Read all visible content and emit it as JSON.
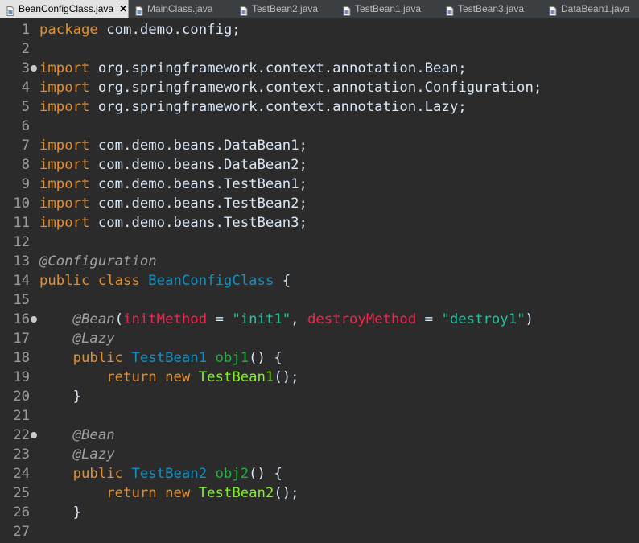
{
  "tabs": [
    {
      "label": "BeanConfigClass.java",
      "active": true,
      "close": "✕",
      "icon": "java-file-icon"
    },
    {
      "label": "MainClass.java",
      "active": false,
      "icon": "java-file-icon"
    },
    {
      "label": "TestBean2.java",
      "active": false,
      "icon": "java-file-icon"
    },
    {
      "label": "TestBean1.java",
      "active": false,
      "icon": "java-file-icon"
    },
    {
      "label": "TestBean3.java",
      "active": false,
      "icon": "java-file-icon"
    },
    {
      "label": "DataBean1.java",
      "active": false,
      "icon": "java-file-icon"
    }
  ],
  "code": {
    "lines": [
      {
        "n": "1",
        "fold": false,
        "tokens": [
          {
            "t": "package",
            "k": "kw"
          },
          {
            "t": " com.demo.config;",
            "k": "pl"
          }
        ]
      },
      {
        "n": "2",
        "fold": false,
        "tokens": []
      },
      {
        "n": "3",
        "fold": true,
        "tokens": [
          {
            "t": "import",
            "k": "kw"
          },
          {
            "t": " org.springframework.context.annotation.Bean;",
            "k": "pl"
          }
        ]
      },
      {
        "n": "4",
        "fold": false,
        "tokens": [
          {
            "t": "import",
            "k": "kw"
          },
          {
            "t": " org.springframework.context.annotation.Configuration;",
            "k": "pl"
          }
        ]
      },
      {
        "n": "5",
        "fold": false,
        "tokens": [
          {
            "t": "import",
            "k": "kw"
          },
          {
            "t": " org.springframework.context.annotation.Lazy;",
            "k": "pl"
          }
        ]
      },
      {
        "n": "6",
        "fold": false,
        "tokens": []
      },
      {
        "n": "7",
        "fold": false,
        "tokens": [
          {
            "t": "import",
            "k": "kw"
          },
          {
            "t": " com.demo.beans.DataBean1;",
            "k": "pl"
          }
        ]
      },
      {
        "n": "8",
        "fold": false,
        "tokens": [
          {
            "t": "import",
            "k": "kw"
          },
          {
            "t": " com.demo.beans.DataBean2;",
            "k": "pl"
          }
        ]
      },
      {
        "n": "9",
        "fold": false,
        "tokens": [
          {
            "t": "import",
            "k": "kw"
          },
          {
            "t": " com.demo.beans.TestBean1;",
            "k": "pl"
          }
        ]
      },
      {
        "n": "10",
        "fold": false,
        "tokens": [
          {
            "t": "import",
            "k": "kw"
          },
          {
            "t": " com.demo.beans.TestBean2;",
            "k": "pl"
          }
        ]
      },
      {
        "n": "11",
        "fold": false,
        "tokens": [
          {
            "t": "import",
            "k": "kw"
          },
          {
            "t": " com.demo.beans.TestBean3;",
            "k": "pl"
          }
        ]
      },
      {
        "n": "12",
        "fold": false,
        "tokens": []
      },
      {
        "n": "13",
        "fold": false,
        "tokens": [
          {
            "t": "@Configuration",
            "k": "ann"
          }
        ]
      },
      {
        "n": "14",
        "fold": false,
        "tokens": [
          {
            "t": "public",
            "k": "kw"
          },
          {
            "t": " ",
            "k": "pl"
          },
          {
            "t": "class",
            "k": "kw"
          },
          {
            "t": " ",
            "k": "pl"
          },
          {
            "t": "BeanConfigClass",
            "k": "cls"
          },
          {
            "t": " {",
            "k": "pl"
          }
        ]
      },
      {
        "n": "15",
        "fold": false,
        "tokens": []
      },
      {
        "n": "16",
        "fold": true,
        "tokens": [
          {
            "t": "    ",
            "k": "pl"
          },
          {
            "t": "@Bean",
            "k": "ann"
          },
          {
            "t": "(",
            "k": "pl"
          },
          {
            "t": "initMethod",
            "k": "prm"
          },
          {
            "t": " = ",
            "k": "pl"
          },
          {
            "t": "\"init1\"",
            "k": "str"
          },
          {
            "t": ", ",
            "k": "pl"
          },
          {
            "t": "destroyMethod",
            "k": "prm"
          },
          {
            "t": " = ",
            "k": "pl"
          },
          {
            "t": "\"destroy1\"",
            "k": "str"
          },
          {
            "t": ")",
            "k": "pl"
          }
        ]
      },
      {
        "n": "17",
        "fold": false,
        "tokens": [
          {
            "t": "    ",
            "k": "pl"
          },
          {
            "t": "@Lazy",
            "k": "ann"
          }
        ]
      },
      {
        "n": "18",
        "fold": false,
        "tokens": [
          {
            "t": "    ",
            "k": "pl"
          },
          {
            "t": "public",
            "k": "kw"
          },
          {
            "t": " ",
            "k": "pl"
          },
          {
            "t": "TestBean1",
            "k": "typ"
          },
          {
            "t": " ",
            "k": "pl"
          },
          {
            "t": "obj1",
            "k": "mth"
          },
          {
            "t": "() {",
            "k": "pl"
          }
        ]
      },
      {
        "n": "19",
        "fold": false,
        "tokens": [
          {
            "t": "        ",
            "k": "pl"
          },
          {
            "t": "return",
            "k": "kw"
          },
          {
            "t": " ",
            "k": "pl"
          },
          {
            "t": "new",
            "k": "kw"
          },
          {
            "t": " ",
            "k": "pl"
          },
          {
            "t": "TestBean1",
            "k": "ctor"
          },
          {
            "t": "();",
            "k": "pl"
          }
        ]
      },
      {
        "n": "20",
        "fold": false,
        "tokens": [
          {
            "t": "    }",
            "k": "pl"
          }
        ]
      },
      {
        "n": "21",
        "fold": false,
        "tokens": []
      },
      {
        "n": "22",
        "fold": true,
        "tokens": [
          {
            "t": "    ",
            "k": "pl"
          },
          {
            "t": "@Bean",
            "k": "ann"
          }
        ]
      },
      {
        "n": "23",
        "fold": false,
        "tokens": [
          {
            "t": "    ",
            "k": "pl"
          },
          {
            "t": "@Lazy",
            "k": "ann"
          }
        ]
      },
      {
        "n": "24",
        "fold": false,
        "tokens": [
          {
            "t": "    ",
            "k": "pl"
          },
          {
            "t": "public",
            "k": "kw"
          },
          {
            "t": " ",
            "k": "pl"
          },
          {
            "t": "TestBean2",
            "k": "typ"
          },
          {
            "t": " ",
            "k": "pl"
          },
          {
            "t": "obj2",
            "k": "mth"
          },
          {
            "t": "() {",
            "k": "pl"
          }
        ]
      },
      {
        "n": "25",
        "fold": false,
        "tokens": [
          {
            "t": "        ",
            "k": "pl"
          },
          {
            "t": "return",
            "k": "kw"
          },
          {
            "t": " ",
            "k": "pl"
          },
          {
            "t": "new",
            "k": "kw"
          },
          {
            "t": " ",
            "k": "pl"
          },
          {
            "t": "TestBean2",
            "k": "ctor"
          },
          {
            "t": "();",
            "k": "pl"
          }
        ]
      },
      {
        "n": "26",
        "fold": false,
        "tokens": [
          {
            "t": "    }",
            "k": "pl"
          }
        ]
      },
      {
        "n": "27",
        "fold": false,
        "tokens": []
      }
    ]
  }
}
